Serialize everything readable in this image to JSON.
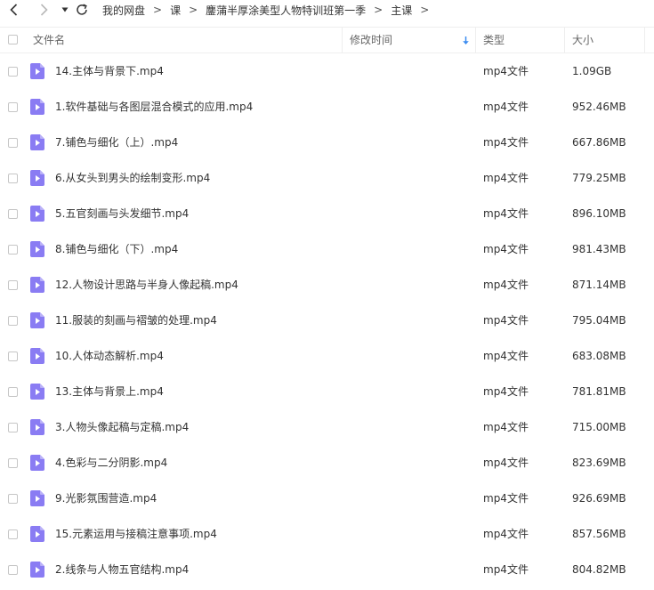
{
  "toolbar": {
    "icons": [
      "chevron-left-icon",
      "chevron-right-icon",
      "caret-down-icon",
      "refresh-icon"
    ]
  },
  "breadcrumb": {
    "items": [
      "我的网盘",
      "课",
      "鏖蒲半厚涂美型人物特训班第一季",
      "主课"
    ],
    "separator": ">"
  },
  "columns": {
    "name": "文件名",
    "modified": "修改时间",
    "type": "类型",
    "size": "大小"
  },
  "colors": {
    "file_icon": "#8a7cf3",
    "sort_arrow": "#3b8cf0"
  },
  "files": [
    {
      "name": "14.主体与背景下.mp4",
      "type": "mp4文件",
      "size": "1.09GB"
    },
    {
      "name": "1.软件基础与各图层混合模式的应用.mp4",
      "type": "mp4文件",
      "size": "952.46MB"
    },
    {
      "name": "7.铺色与细化（上）.mp4",
      "type": "mp4文件",
      "size": "667.86MB"
    },
    {
      "name": "6.从女头到男头的绘制变形.mp4",
      "type": "mp4文件",
      "size": "779.25MB"
    },
    {
      "name": "5.五官刻画与头发细节.mp4",
      "type": "mp4文件",
      "size": "896.10MB"
    },
    {
      "name": "8.铺色与细化（下）.mp4",
      "type": "mp4文件",
      "size": "981.43MB"
    },
    {
      "name": "12.人物设计思路与半身人像起稿.mp4",
      "type": "mp4文件",
      "size": "871.14MB"
    },
    {
      "name": "11.服装的刻画与褶皱的处理.mp4",
      "type": "mp4文件",
      "size": "795.04MB"
    },
    {
      "name": "10.人体动态解析.mp4",
      "type": "mp4文件",
      "size": "683.08MB"
    },
    {
      "name": "13.主体与背景上.mp4",
      "type": "mp4文件",
      "size": "781.81MB"
    },
    {
      "name": "3.人物头像起稿与定稿.mp4",
      "type": "mp4文件",
      "size": "715.00MB"
    },
    {
      "name": "4.色彩与二分阴影.mp4",
      "type": "mp4文件",
      "size": "823.69MB"
    },
    {
      "name": "9.光影氛围营造.mp4",
      "type": "mp4文件",
      "size": "926.69MB"
    },
    {
      "name": "15.元素运用与接稿注意事项.mp4",
      "type": "mp4文件",
      "size": "857.56MB"
    },
    {
      "name": "2.线条与人物五官结构.mp4",
      "type": "mp4文件",
      "size": "804.82MB"
    }
  ]
}
